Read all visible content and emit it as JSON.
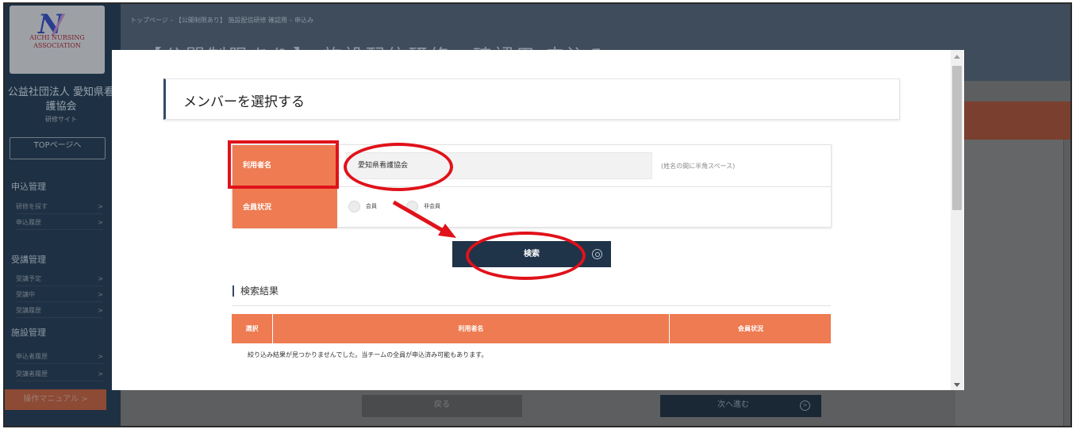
{
  "sidebar": {
    "logo_line1": "AICHI NURSING",
    "logo_line2": "ASSOCIATION",
    "org_name": "公益社団法人 愛知県看護協会",
    "org_sub": "研修サイト",
    "top_button": "TOPページへ",
    "sections": [
      {
        "title": "申込管理",
        "items": [
          "研修を探す",
          "申込履歴"
        ]
      },
      {
        "title": "受講管理",
        "items": [
          "受講予定",
          "受講中",
          "受講履歴"
        ]
      },
      {
        "title": "施設管理",
        "items": [
          "申込者履歴",
          "受講者履歴"
        ]
      }
    ],
    "manual_button": "操作マニュアル >"
  },
  "header": {
    "breadcrumb": "トップページ – 【公開制限あり】 施設配信研修 確認用 – 申込み",
    "title": "【公開制限あり】 施設配信研修　確認用 申込み"
  },
  "footer_buttons": {
    "back": "戻る",
    "next": "次へ進む"
  },
  "modal": {
    "heading": "メンバーを選択する",
    "form": {
      "name_label": "利用者名",
      "name_value": "愛知県看護協会",
      "name_hint": "(姓名の間に半角スペース)",
      "status_label": "会員状況",
      "options": [
        "会員",
        "非会員"
      ]
    },
    "search_button": "検索",
    "results": {
      "heading": "検索結果",
      "columns": [
        "選択",
        "利用者名",
        "会員状況"
      ],
      "empty_message": "絞り込み結果が見つかりませんでした。当チームの全員が申込済み可能もあります。"
    }
  },
  "colors": {
    "accent_orange": "#ee7b51",
    "navy": "#1f3349",
    "annotation_red": "#e0121a"
  }
}
